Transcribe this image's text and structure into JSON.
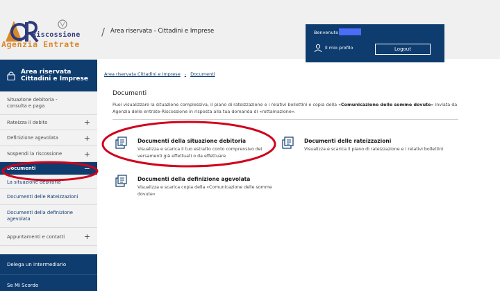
{
  "header": {
    "logo_line1": "Riscossione",
    "logo_line2": "Agenzia Entrate",
    "section_title": "Area riservata - Cittadini e Imprese",
    "separator": "/"
  },
  "user": {
    "welcome": "Benvenuto",
    "profile_label": "Il mio profilo",
    "logout_label": "Logout"
  },
  "sidebar": {
    "title_line1": "Area riservata",
    "title_line2": "Cittadini e Imprese",
    "items": [
      {
        "label": "Situazione debitoria - consulta e paga",
        "expander": ""
      },
      {
        "label": "Rateizza il debito",
        "expander": "+"
      },
      {
        "label": "Definizione agevolata",
        "expander": "+"
      },
      {
        "label": "Sospendi la riscossione",
        "expander": "+"
      },
      {
        "label": "Documenti",
        "expander": "−"
      },
      {
        "label": "La situazione debitoria",
        "expander": ""
      },
      {
        "label": "Documenti delle Rateizzazioni",
        "expander": ""
      },
      {
        "label": "Documenti della definizione agevolata",
        "expander": ""
      },
      {
        "label": "Appuntamenti e contatti",
        "expander": "+"
      },
      {
        "label": "Delega un intermediario",
        "expander": ""
      },
      {
        "label": "Se Mi Scordo",
        "expander": ""
      }
    ]
  },
  "breadcrumb": {
    "root": "Area riservata Cittadini e Imprese",
    "sep": "-",
    "current": "Documenti"
  },
  "main": {
    "title": "Documenti",
    "desc_part1": "Puoi visualizzare la situazione complessiva, il piano di rateizzazione e i relativi bollettini e copia della «",
    "desc_bold": "Comunicazione delle somme dovute",
    "desc_part2": "» inviata da Agenzia delle entrate-Riscossione in risposta alla tua domanda di «rottamazione».",
    "cards": [
      {
        "title": "Documenti della situazione debitoria",
        "desc": "Visualizza e scarica il tuo estratto conto comprensivo dei versamenti già effettuati o da effettuare"
      },
      {
        "title": "Documenti delle rateizzazioni",
        "desc": "Visualizza e scarica il piano di rateizzazione e i relativi bollettini"
      },
      {
        "title": "Documenti della definizione agevolata",
        "desc": "Visualizza e scarica copia della «Comunicazione delle somme dovute»"
      }
    ]
  },
  "colors": {
    "primary": "#0e3c6e",
    "accent": "#d9882c",
    "annotation": "#d0021b"
  }
}
